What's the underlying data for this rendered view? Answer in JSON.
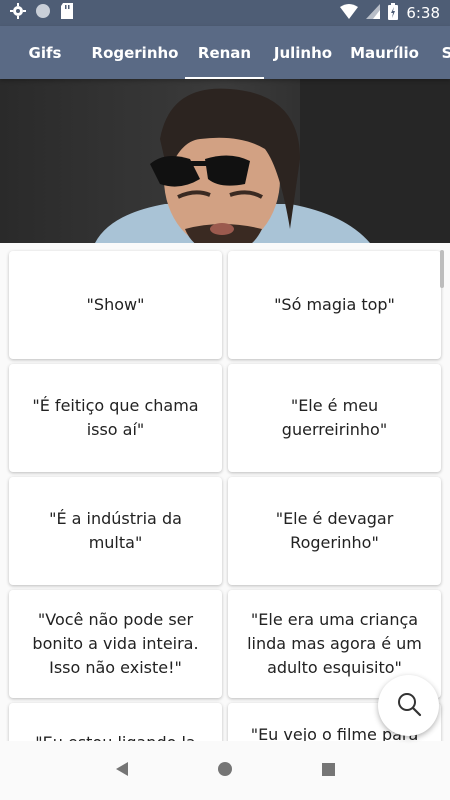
{
  "status": {
    "time": "6:38"
  },
  "tabs": [
    {
      "label": "Gifs"
    },
    {
      "label": "Rogerinho"
    },
    {
      "label": "Renan"
    },
    {
      "label": "Julinho"
    },
    {
      "label": "Maurílio"
    },
    {
      "label": "S"
    }
  ],
  "active_tab": "Renan",
  "quotes": [
    "\"Show\"",
    "\"Só magia top\"",
    "\"É feitiço que chama isso aí\"",
    "\"Ele é meu guerreirinho\"",
    "\"É a indústria da multa\"",
    "\"Ele é devagar Rogerinho\"",
    "\"Você não pode ser bonito a vida inteira. Isso não existe!\"",
    "\"Ele era uma criança linda mas agora é um adulto esquisito\"",
    "\"Eu estou ligando la",
    "\"Eu vejo o filme para"
  ],
  "colors": {
    "status_bar": "#4e5d75",
    "tab_bar": "#5a6a85"
  },
  "icons": {
    "search": "search-icon"
  }
}
